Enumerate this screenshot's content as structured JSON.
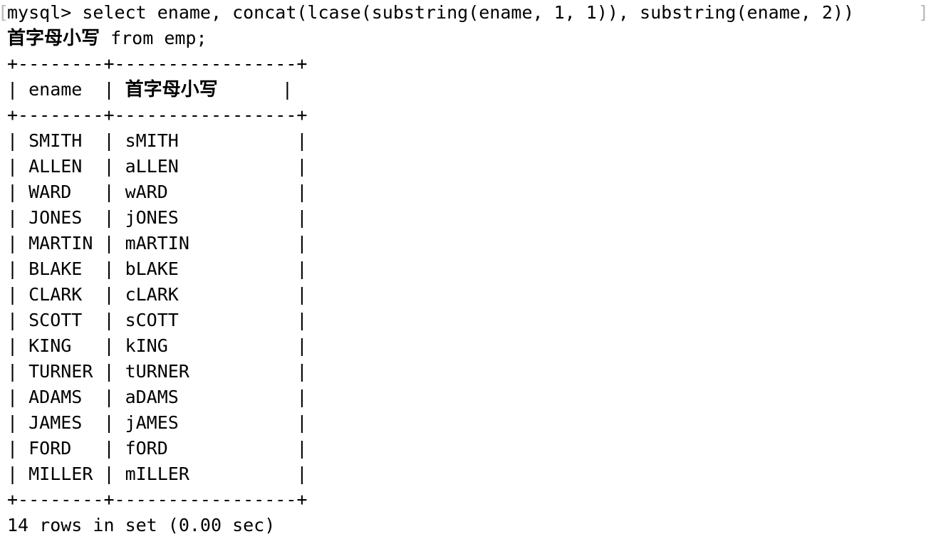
{
  "terminal": {
    "prompt": "mysql>",
    "edge_artifact_left": "[",
    "edge_artifact_right": "]",
    "query_line_1": "mysql> select ename, concat(lcase(substring(ename, 1, 1)), substring(ename, 2)) ",
    "query_line_1_visible_tail": "]",
    "query_line_2_prefix": "首字母小写",
    "query_line_2_suffix": " from emp;",
    "full_query": "select ename, concat(lcase(substring(ename, 1, 1)), substring(ename, 2)) 首字母小写 from emp;",
    "separator": "+--------+-----------------+",
    "header_row": "| ename  | 首字母小写      |",
    "result_footer": "14 rows in set (0.00 sec)",
    "row_count": 14,
    "elapsed": "0.00 sec",
    "colors": {
      "background": "#ffffff",
      "foreground": "#000000",
      "clipped_edge": "#b9b9b9"
    }
  },
  "table": {
    "columns": [
      {
        "name": "ename",
        "width": 8
      },
      {
        "name": "首字母小写",
        "width": 17
      }
    ],
    "rows": [
      {
        "ename": "SMITH",
        "alias": "sMITH"
      },
      {
        "ename": "ALLEN",
        "alias": "aLLEN"
      },
      {
        "ename": "WARD",
        "alias": "wARD"
      },
      {
        "ename": "JONES",
        "alias": "jONES"
      },
      {
        "ename": "MARTIN",
        "alias": "mARTIN"
      },
      {
        "ename": "BLAKE",
        "alias": "bLAKE"
      },
      {
        "ename": "CLARK",
        "alias": "cLARK"
      },
      {
        "ename": "SCOTT",
        "alias": "sCOTT"
      },
      {
        "ename": "KING",
        "alias": "kING"
      },
      {
        "ename": "TURNER",
        "alias": "tURNER"
      },
      {
        "ename": "ADAMS",
        "alias": "aDAMS"
      },
      {
        "ename": "JAMES",
        "alias": "jAMES"
      },
      {
        "ename": "FORD",
        "alias": "fORD"
      },
      {
        "ename": "MILLER",
        "alias": "mILLER"
      }
    ]
  }
}
